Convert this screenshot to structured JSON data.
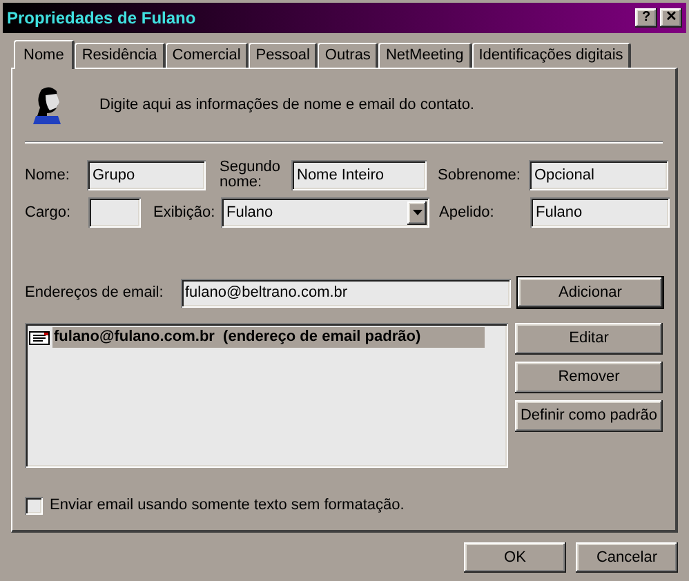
{
  "window": {
    "title": "Propriedades de Fulano",
    "controls": [
      "?",
      "✕"
    ]
  },
  "tabs": [
    {
      "label": "Nome",
      "selected": true
    },
    {
      "label": "Residência",
      "selected": false
    },
    {
      "label": "Comercial",
      "selected": false
    },
    {
      "label": "Pessoal",
      "selected": false
    },
    {
      "label": "Outras",
      "selected": false
    },
    {
      "label": "NetMeeting",
      "selected": false
    },
    {
      "label": "Identificações digitais",
      "selected": false
    }
  ],
  "intro": "Digite aqui as informações de nome e email do contato.",
  "field_rows": [
    [
      {
        "label": "Nome:",
        "value": "Grupo",
        "kind": "text"
      },
      {
        "label": "Segundo nome:",
        "value": "Nome Inteiro",
        "kind": "text"
      },
      {
        "label": "Sobrenome:",
        "value": "Opcional",
        "kind": "text"
      }
    ],
    [
      {
        "label": "Cargo:",
        "kind": "text"
      },
      {
        "label": "Exibição:",
        "value": "Fulano",
        "kind": "combo"
      },
      {
        "label": "Apelido:",
        "value": "Fulano",
        "kind": "text"
      }
    ]
  ],
  "email": {
    "label": "Endereços de email:",
    "value": "fulano@beltrano.com.br",
    "button": "Adicionar"
  },
  "email_list": [
    {
      "text": "fulano@fulano.com.br  (endereço de email padrão)",
      "selected": true
    }
  ],
  "side_buttons": [
    "Editar",
    "Remover",
    "Definir como padrão"
  ],
  "plain_text_option": {
    "label": "Enviar email usando somente texto sem formatação.",
    "checked": false
  },
  "footer_buttons": [
    "OK",
    "Cancelar"
  ]
}
